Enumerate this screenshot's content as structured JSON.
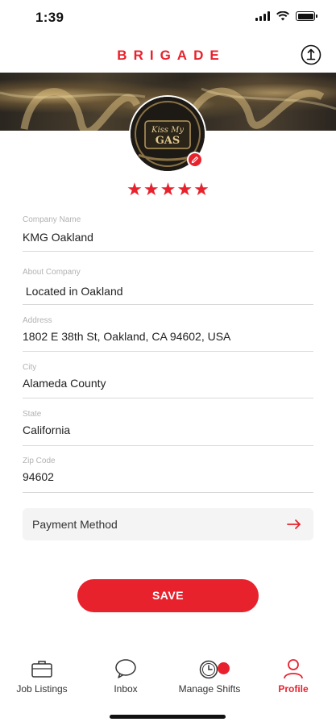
{
  "status_bar": {
    "time": "1:39"
  },
  "header": {
    "brand": "BRIGADE",
    "share_icon": "share-icon"
  },
  "profile": {
    "logo_text": "Kiss My GAS",
    "rating": 5,
    "stars": [
      "★",
      "★",
      "★",
      "★",
      "★"
    ]
  },
  "form": {
    "fields": [
      {
        "label": "Company Name",
        "value": "KMG Oakland"
      },
      {
        "label": "About Company",
        "value": " Located in Oakland"
      },
      {
        "label": "Address",
        "value": "1802 E 38th St, Oakland, CA 94602, USA"
      },
      {
        "label": "City",
        "value": "Alameda County"
      },
      {
        "label": "State",
        "value": "California"
      },
      {
        "label": "Zip Code",
        "value": "94602"
      }
    ],
    "payment_method": "Payment Method",
    "save_label": "SAVE"
  },
  "tabs": [
    {
      "label": "Job Listings",
      "icon": "briefcase-icon"
    },
    {
      "label": "Inbox",
      "icon": "chat-bubble-icon"
    },
    {
      "label": "Manage Shifts",
      "icon": "clock-icon"
    },
    {
      "label": "Profile",
      "icon": "person-icon"
    }
  ],
  "colors": {
    "accent": "#e8222d",
    "field_label": "#b2b2b2",
    "payment_bg": "#f4f4f4"
  }
}
